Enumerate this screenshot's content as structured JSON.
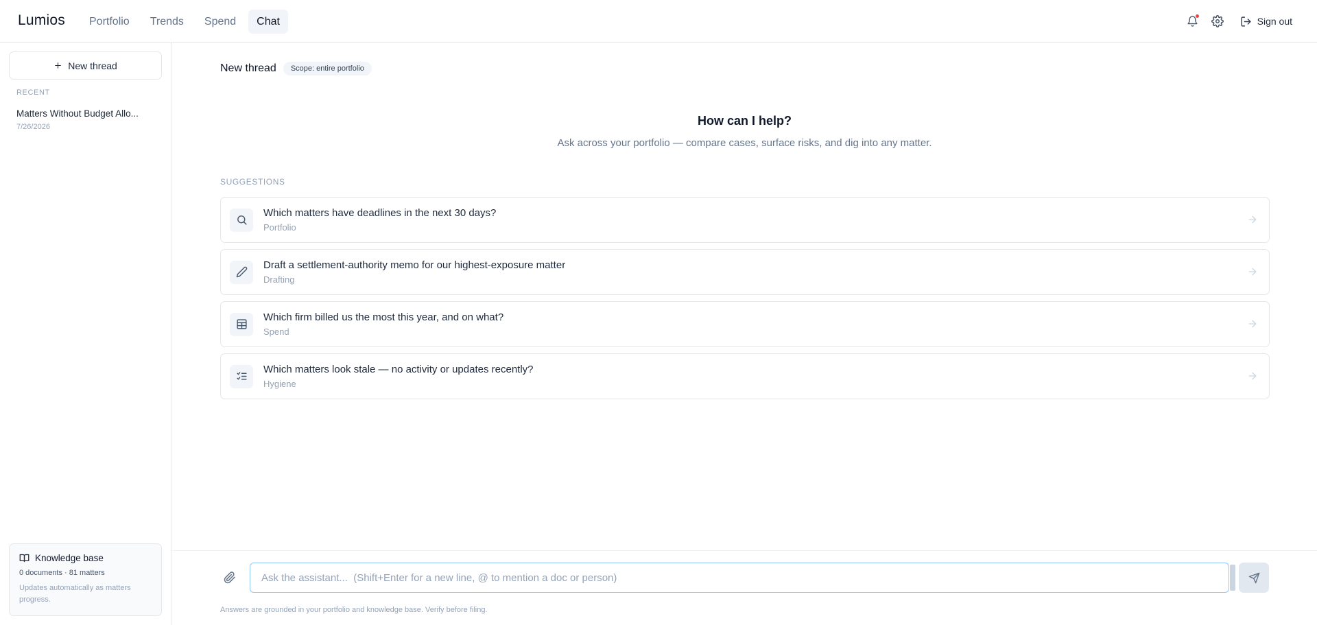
{
  "app": {
    "brand": "Lumios"
  },
  "nav": {
    "items": [
      {
        "label": "Portfolio",
        "active": false
      },
      {
        "label": "Trends",
        "active": false
      },
      {
        "label": "Spend",
        "active": false
      },
      {
        "label": "Chat",
        "active": true
      }
    ],
    "signout_label": "Sign out",
    "icons": [
      "bell-icon",
      "gear-icon",
      "sign-out-icon"
    ],
    "notification_dot_color": "#ef4444"
  },
  "sidebar": {
    "new_thread_label": "New thread",
    "recent_label": "RECENT",
    "threads": [
      {
        "title": "Matters Without Budget Allo...",
        "date": "7/26/2026"
      }
    ],
    "knowledge_base": {
      "title": "Knowledge base",
      "stats": "0 documents · 81 matters",
      "note": "Updates automatically as matters progress."
    }
  },
  "main": {
    "thread_title": "New thread",
    "scope_badge": "Scope: entire portfolio",
    "hero_title": "How can I help?",
    "hero_subtitle": "Ask across your portfolio — compare cases, surface risks, and dig into any matter.",
    "suggestions_label": "SUGGESTIONS",
    "suggestions": [
      {
        "title": "Which matters have deadlines in the next 30 days?",
        "category": "Portfolio",
        "icon": "search-icon"
      },
      {
        "title": "Draft a settlement-authority memo for our highest-exposure matter",
        "category": "Drafting",
        "icon": "pencil-icon"
      },
      {
        "title": "Which firm billed us the most this year, and on what?",
        "category": "Spend",
        "icon": "table-icon"
      },
      {
        "title": "Which matters look stale — no activity or updates recently?",
        "category": "Hygiene",
        "icon": "checklist-icon"
      }
    ]
  },
  "composer": {
    "placeholder": "Ask the assistant...  (Shift+Enter for a new line, @ to mention a doc or person)",
    "value": "",
    "disclaimer": "Answers are grounded in your portfolio and knowledge base. Verify before filing."
  },
  "colors": {
    "accent_focus": "#93c5fd",
    "muted_text": "#94a3b8",
    "border": "#e5e7eb"
  }
}
